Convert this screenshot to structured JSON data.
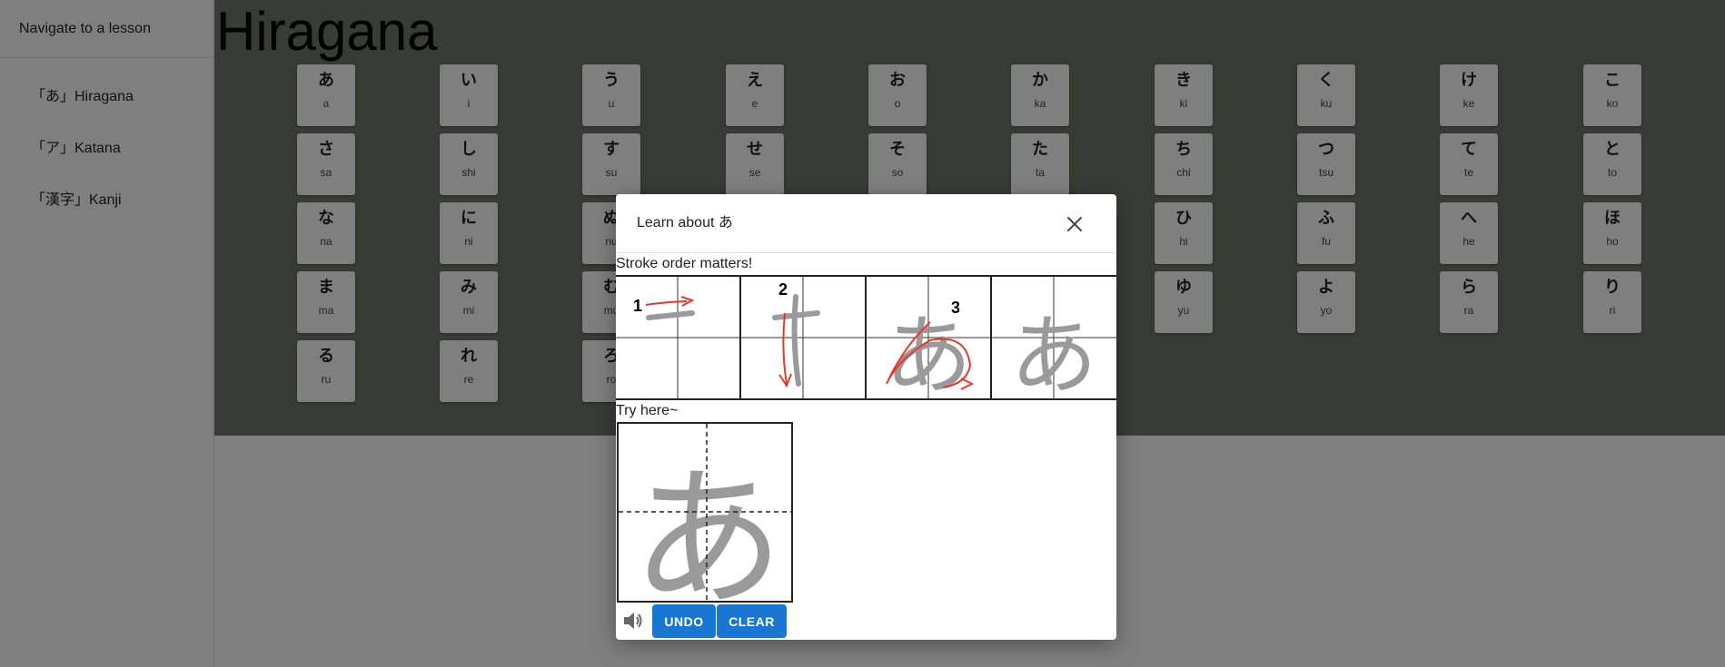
{
  "sidebar": {
    "header": "Navigate to a lesson",
    "items": [
      {
        "label": "「あ」Hiragana"
      },
      {
        "label": "「ア」Katana"
      },
      {
        "label": "「漢字」Kanji"
      }
    ]
  },
  "page": {
    "title": "Hiragana"
  },
  "kana": [
    {
      "char": "あ",
      "romaji": "a"
    },
    {
      "char": "い",
      "romaji": "i"
    },
    {
      "char": "う",
      "romaji": "u"
    },
    {
      "char": "え",
      "romaji": "e"
    },
    {
      "char": "お",
      "romaji": "o"
    },
    {
      "char": "か",
      "romaji": "ka"
    },
    {
      "char": "き",
      "romaji": "ki"
    },
    {
      "char": "く",
      "romaji": "ku"
    },
    {
      "char": "け",
      "romaji": "ke"
    },
    {
      "char": "こ",
      "romaji": "ko"
    },
    {
      "char": "さ",
      "romaji": "sa"
    },
    {
      "char": "し",
      "romaji": "shi"
    },
    {
      "char": "す",
      "romaji": "su"
    },
    {
      "char": "せ",
      "romaji": "se"
    },
    {
      "char": "そ",
      "romaji": "so"
    },
    {
      "char": "た",
      "romaji": "ta"
    },
    {
      "char": "ち",
      "romaji": "chi"
    },
    {
      "char": "つ",
      "romaji": "tsu"
    },
    {
      "char": "て",
      "romaji": "te"
    },
    {
      "char": "と",
      "romaji": "to"
    },
    {
      "char": "な",
      "romaji": "na"
    },
    {
      "char": "に",
      "romaji": "ni"
    },
    {
      "char": "ぬ",
      "romaji": "nu"
    },
    {
      "char": "ひ",
      "romaji": "hi"
    },
    {
      "char": "ふ",
      "romaji": "fu"
    },
    {
      "char": "へ",
      "romaji": "he"
    },
    {
      "char": "ほ",
      "romaji": "ho"
    },
    {
      "char": "ま",
      "romaji": "ma"
    },
    {
      "char": "み",
      "romaji": "mi"
    },
    {
      "char": "む",
      "romaji": "mu"
    },
    {
      "char": "ゆ",
      "romaji": "yu"
    },
    {
      "char": "よ",
      "romaji": "yo"
    },
    {
      "char": "ら",
      "romaji": "ra"
    },
    {
      "char": "り",
      "romaji": "ri"
    },
    {
      "char": "る",
      "romaji": "ru"
    },
    {
      "char": "れ",
      "romaji": "re"
    },
    {
      "char": "ろ",
      "romaji": "ro"
    }
  ],
  "modal": {
    "title": "Learn about あ",
    "stroke_label": "Stroke order matters!",
    "stroke_numbers": [
      "1",
      "2",
      "3"
    ],
    "character": "あ",
    "try_label": "Try here~",
    "undo_label": "UNDO",
    "clear_label": "CLEAR",
    "close_icon": "close-icon",
    "sound_icon": "speaker-icon",
    "accent_color": "#1976d2",
    "stroke_arrow_color": "#e53a2a",
    "guide_char_color": "#9a9a9a"
  }
}
